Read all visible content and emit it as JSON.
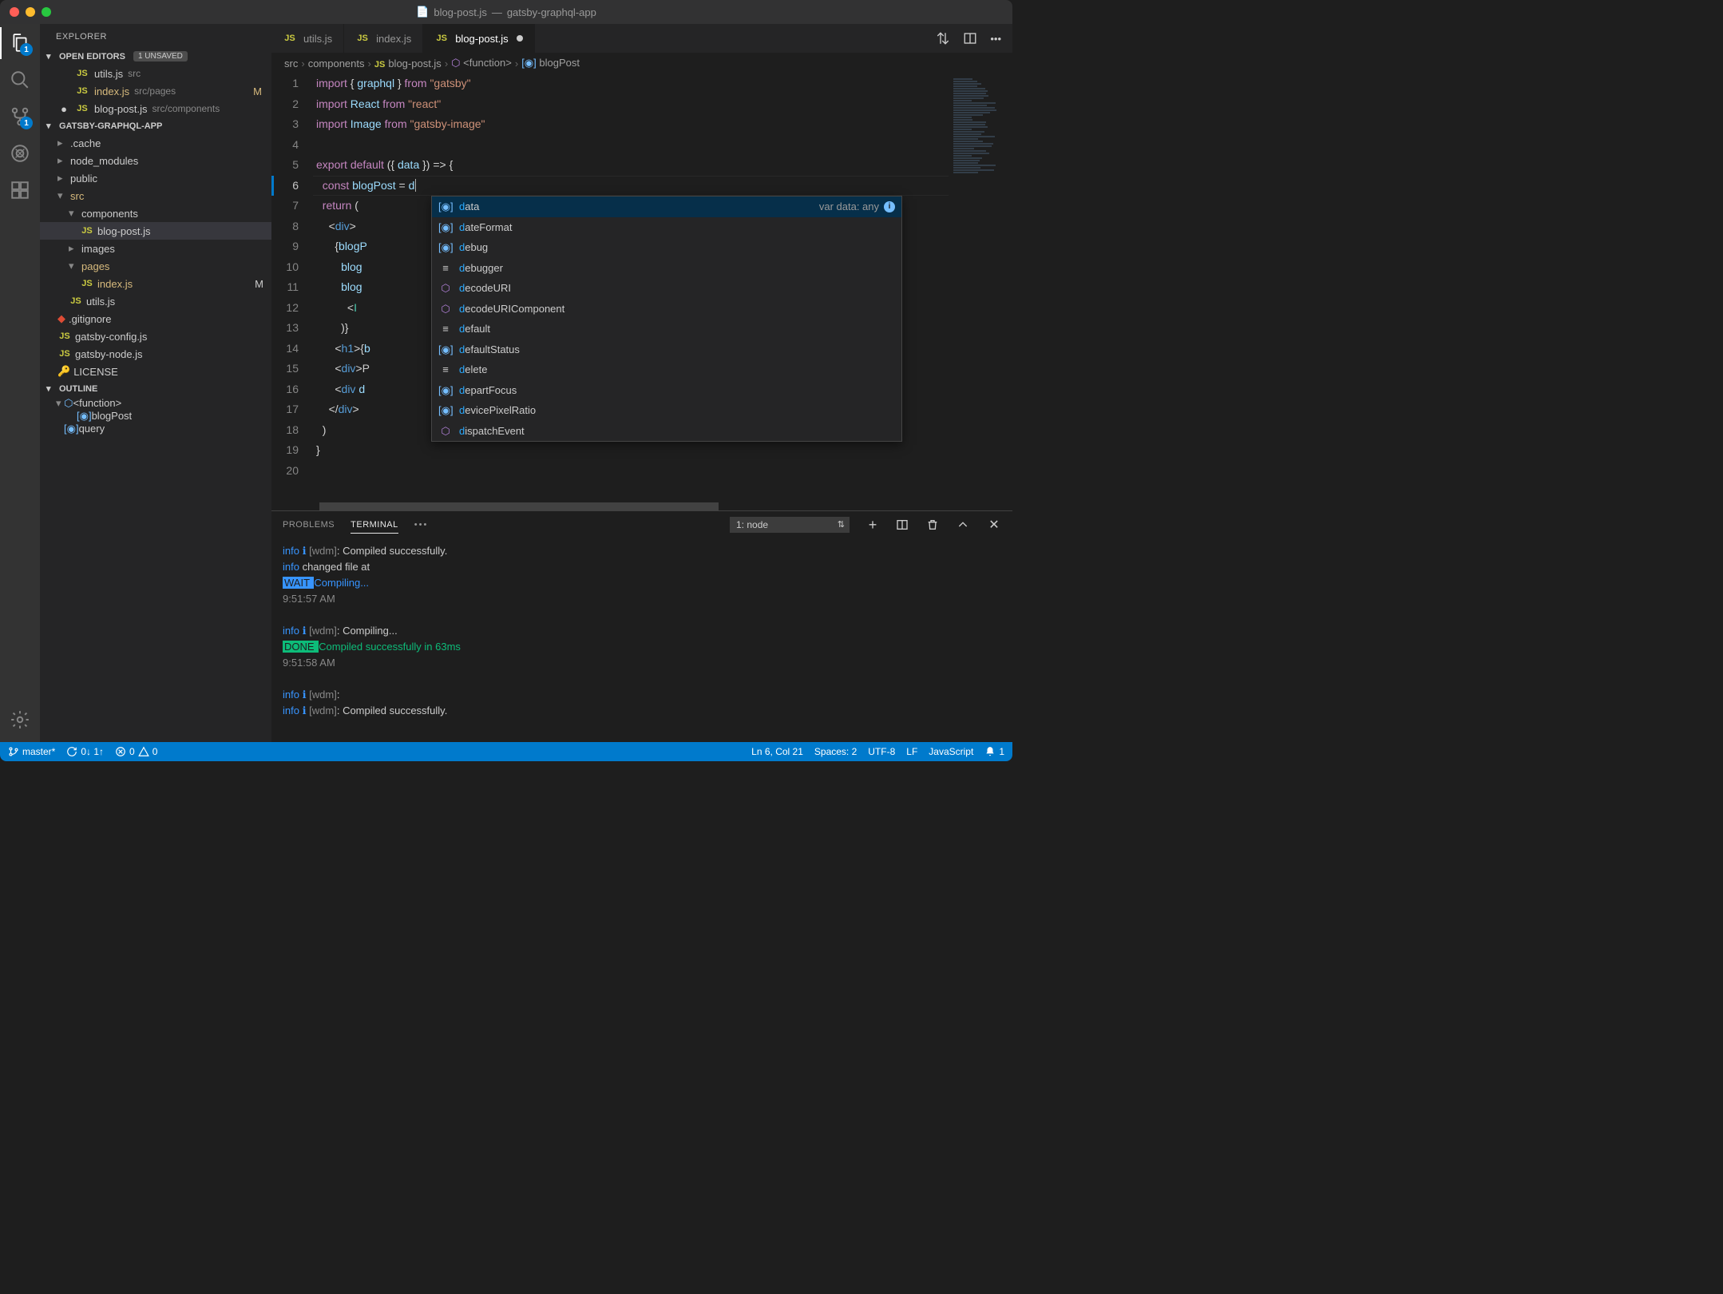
{
  "title": {
    "file": "blog-post.js",
    "project": "gatsby-graphql-app"
  },
  "activity": {
    "explorer_badge": "1",
    "scm_badge": "1"
  },
  "sidebar": {
    "title": "EXPLORER",
    "open_editors": {
      "label": "OPEN EDITORS",
      "unsaved": "1 UNSAVED"
    },
    "editors": [
      {
        "icon": "JS",
        "name": "utils.js",
        "path": "src",
        "status": ""
      },
      {
        "icon": "JS",
        "name": "index.js",
        "path": "src/pages",
        "status": "M",
        "mod": true
      },
      {
        "icon": "JS",
        "name": "blog-post.js",
        "path": "src/components",
        "status": "●",
        "dirty": true
      }
    ],
    "project": "GATSBY-GRAPHQL-APP",
    "tree": [
      {
        "d": 1,
        "t": "f",
        "name": ".cache",
        "chev": "▸"
      },
      {
        "d": 1,
        "t": "f",
        "name": "node_modules",
        "chev": "▸"
      },
      {
        "d": 1,
        "t": "f",
        "name": "public",
        "chev": "▸"
      },
      {
        "d": 1,
        "t": "f",
        "name": "src",
        "chev": "▾",
        "mod": true,
        "dot": true
      },
      {
        "d": 2,
        "t": "f",
        "name": "components",
        "chev": "▾"
      },
      {
        "d": 3,
        "t": "js",
        "name": "blog-post.js",
        "sel": true
      },
      {
        "d": 2,
        "t": "f",
        "name": "images",
        "chev": "▸"
      },
      {
        "d": 2,
        "t": "f",
        "name": "pages",
        "chev": "▾",
        "mod": true,
        "dot": true
      },
      {
        "d": 3,
        "t": "js",
        "name": "index.js",
        "mod": true,
        "M": true
      },
      {
        "d": 2,
        "t": "js",
        "name": "utils.js"
      },
      {
        "d": 1,
        "t": "git",
        "name": ".gitignore"
      },
      {
        "d": 1,
        "t": "js",
        "name": "gatsby-config.js"
      },
      {
        "d": 1,
        "t": "js",
        "name": "gatsby-node.js"
      },
      {
        "d": 1,
        "t": "lic",
        "name": "LICENSE"
      }
    ],
    "outline": {
      "label": "OUTLINE",
      "items": [
        "<function>",
        "blogPost",
        "query"
      ]
    }
  },
  "tabs": [
    {
      "name": "utils.js"
    },
    {
      "name": "index.js"
    },
    {
      "name": "blog-post.js",
      "active": true,
      "dirty": true
    }
  ],
  "breadcrumb": [
    "src",
    "components",
    "blog-post.js",
    "<function>",
    "blogPost"
  ],
  "code": {
    "lines": 20,
    "current": 6
  },
  "suggest": {
    "hint": "var data: any",
    "items": [
      {
        "icon": "var",
        "label": "data",
        "sel": true
      },
      {
        "icon": "var",
        "label": "dateFormat"
      },
      {
        "icon": "var",
        "label": "debug"
      },
      {
        "icon": "kw",
        "label": "debugger"
      },
      {
        "icon": "fn",
        "label": "decodeURI"
      },
      {
        "icon": "fn",
        "label": "decodeURIComponent"
      },
      {
        "icon": "kw",
        "label": "default"
      },
      {
        "icon": "var",
        "label": "defaultStatus"
      },
      {
        "icon": "kw",
        "label": "delete"
      },
      {
        "icon": "var",
        "label": "departFocus"
      },
      {
        "icon": "var",
        "label": "devicePixelRatio"
      },
      {
        "icon": "fn",
        "label": "dispatchEvent"
      }
    ]
  },
  "panel": {
    "tabs": {
      "problems": "PROBLEMS",
      "terminal": "TERMINAL"
    },
    "dropdown": "1: node",
    "terminal": [
      {
        "p": "info",
        "i": "ℹ",
        "tag": "[wdm]",
        "msg": ": Compiled successfully."
      },
      {
        "p": "info",
        "msg": " changed file at"
      },
      {
        "p": "wait",
        "msg": " Compiling..."
      },
      {
        "time": "9:51:57 AM"
      },
      {
        "blank": true
      },
      {
        "p": "info",
        "i": "ℹ",
        "tag": "[wdm]",
        "msg": ": Compiling..."
      },
      {
        "p": "done",
        "msg": " Compiled successfully in 63ms"
      },
      {
        "time": "9:51:58 AM"
      },
      {
        "blank": true
      },
      {
        "p": "info",
        "i": "ℹ",
        "tag": "[wdm]",
        "msg": ":"
      },
      {
        "p": "info",
        "i": "ℹ",
        "tag": "[wdm]",
        "msg": ": Compiled successfully."
      }
    ]
  },
  "status": {
    "branch": "master*",
    "sync": "0↓ 1↑",
    "errors": "0",
    "warnings": "0",
    "cursor": "Ln 6, Col 21",
    "spaces": "Spaces: 2",
    "encoding": "UTF-8",
    "eol": "LF",
    "lang": "JavaScript",
    "bell": "1"
  }
}
